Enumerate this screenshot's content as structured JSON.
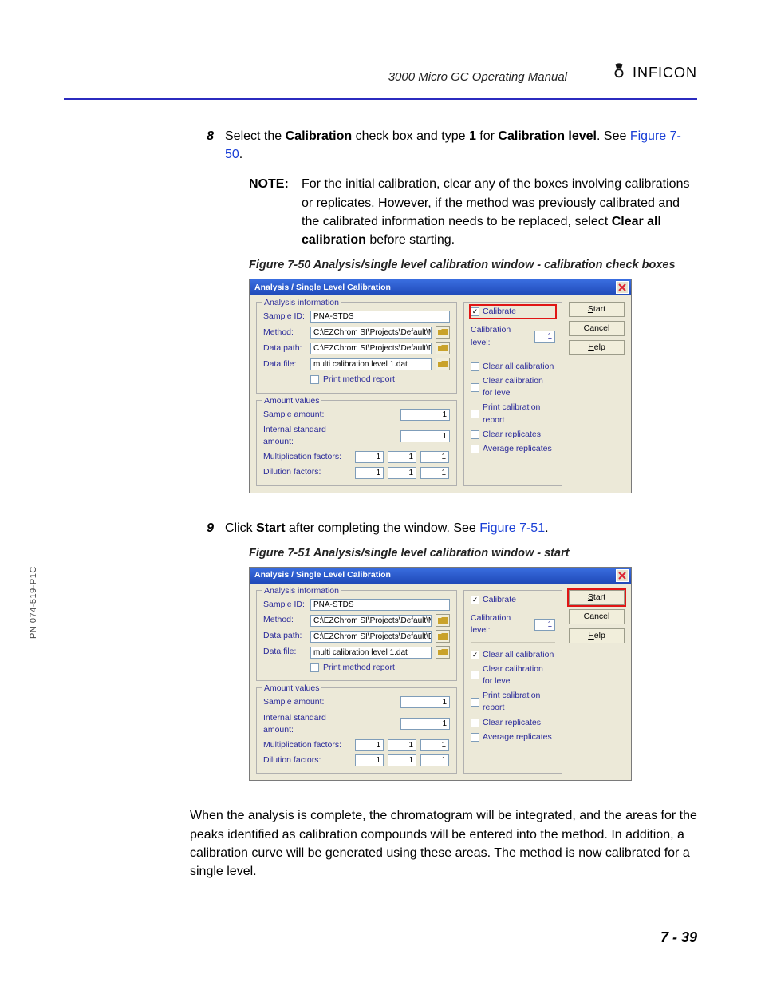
{
  "header": {
    "manual_title": "3000 Micro GC Operating Manual",
    "brand": "INFICON"
  },
  "side_pn": "PN 074-519-P1C",
  "footer": "7 - 39",
  "step8": {
    "num": "8",
    "text_a": "Select the ",
    "b1": "Calibration",
    "text_b": " check box and type ",
    "b2": "1",
    "text_c": " for ",
    "b3": "Calibration level",
    "text_d": ". See ",
    "link": "Figure 7-50",
    "text_e": "."
  },
  "note": {
    "label": "NOTE:",
    "text_a": "For the initial calibration, clear any of the boxes involving calibrations or replicates. However, if the method was previously calibrated and the calibrated information needs to be replaced, select ",
    "bold": "Clear all calibration",
    "text_b": " before starting."
  },
  "fig50_caption": "Figure 7-50  Analysis/single level calibration window - calibration check boxes",
  "fig51_caption": "Figure 7-51  Analysis/single level calibration window - start",
  "step9": {
    "num": "9",
    "text_a": "Click ",
    "b1": "Start",
    "text_b": " after completing the window. See ",
    "link": "Figure 7-51",
    "text_c": "."
  },
  "after_paragraph": "When the analysis is complete, the chromatogram will be integrated, and the areas for the peaks identified as calibration compounds will be entered into the method. In addition, a calibration curve will be generated using these areas. The method is now calibrated for a single level.",
  "dialog": {
    "title": "Analysis / Single Level Calibration",
    "groups": {
      "analysis_info": "Analysis information",
      "amount_values": "Amount values"
    },
    "labels": {
      "sample_id": "Sample ID:",
      "method": "Method:",
      "data_path": "Data path:",
      "data_file": "Data file:",
      "print_method_report": "Print method report",
      "sample_amount": "Sample amount:",
      "internal_std_amount": "Internal standard amount:",
      "mult_factors": "Multiplication factors:",
      "dilution_factors": "Dilution factors:",
      "calibrate": "Calibrate",
      "calibration_level": "Calibration level:",
      "clear_all_calibration": "Clear all calibration",
      "clear_calibration_level": "Clear calibration for level",
      "print_calibration_report": "Print calibration report",
      "clear_replicates": "Clear replicates",
      "average_replicates": "Average replicates"
    },
    "values": {
      "sample_id": "PNA-STDS",
      "method": "C:\\EZChrom SI\\Projects\\Default\\Method\\manual",
      "data_path": "C:\\EZChrom SI\\Projects\\Default\\Data",
      "data_file": "multi calibration level 1.dat",
      "calibration_level": "1",
      "sample_amount": "1",
      "internal_std_amount": "1",
      "mult_1": "1",
      "mult_2": "1",
      "mult_3": "1",
      "dil_1": "1",
      "dil_2": "1",
      "dil_3": "1"
    },
    "buttons": {
      "start_s": "S",
      "start_rest": "tart",
      "cancel": "Cancel",
      "help_h": "H",
      "help_rest": "elp"
    }
  },
  "fig50_state": {
    "clear_all_calibration_checked": false,
    "highlight": "calibrate"
  },
  "fig51_state": {
    "clear_all_calibration_checked": true,
    "highlight": "start"
  }
}
